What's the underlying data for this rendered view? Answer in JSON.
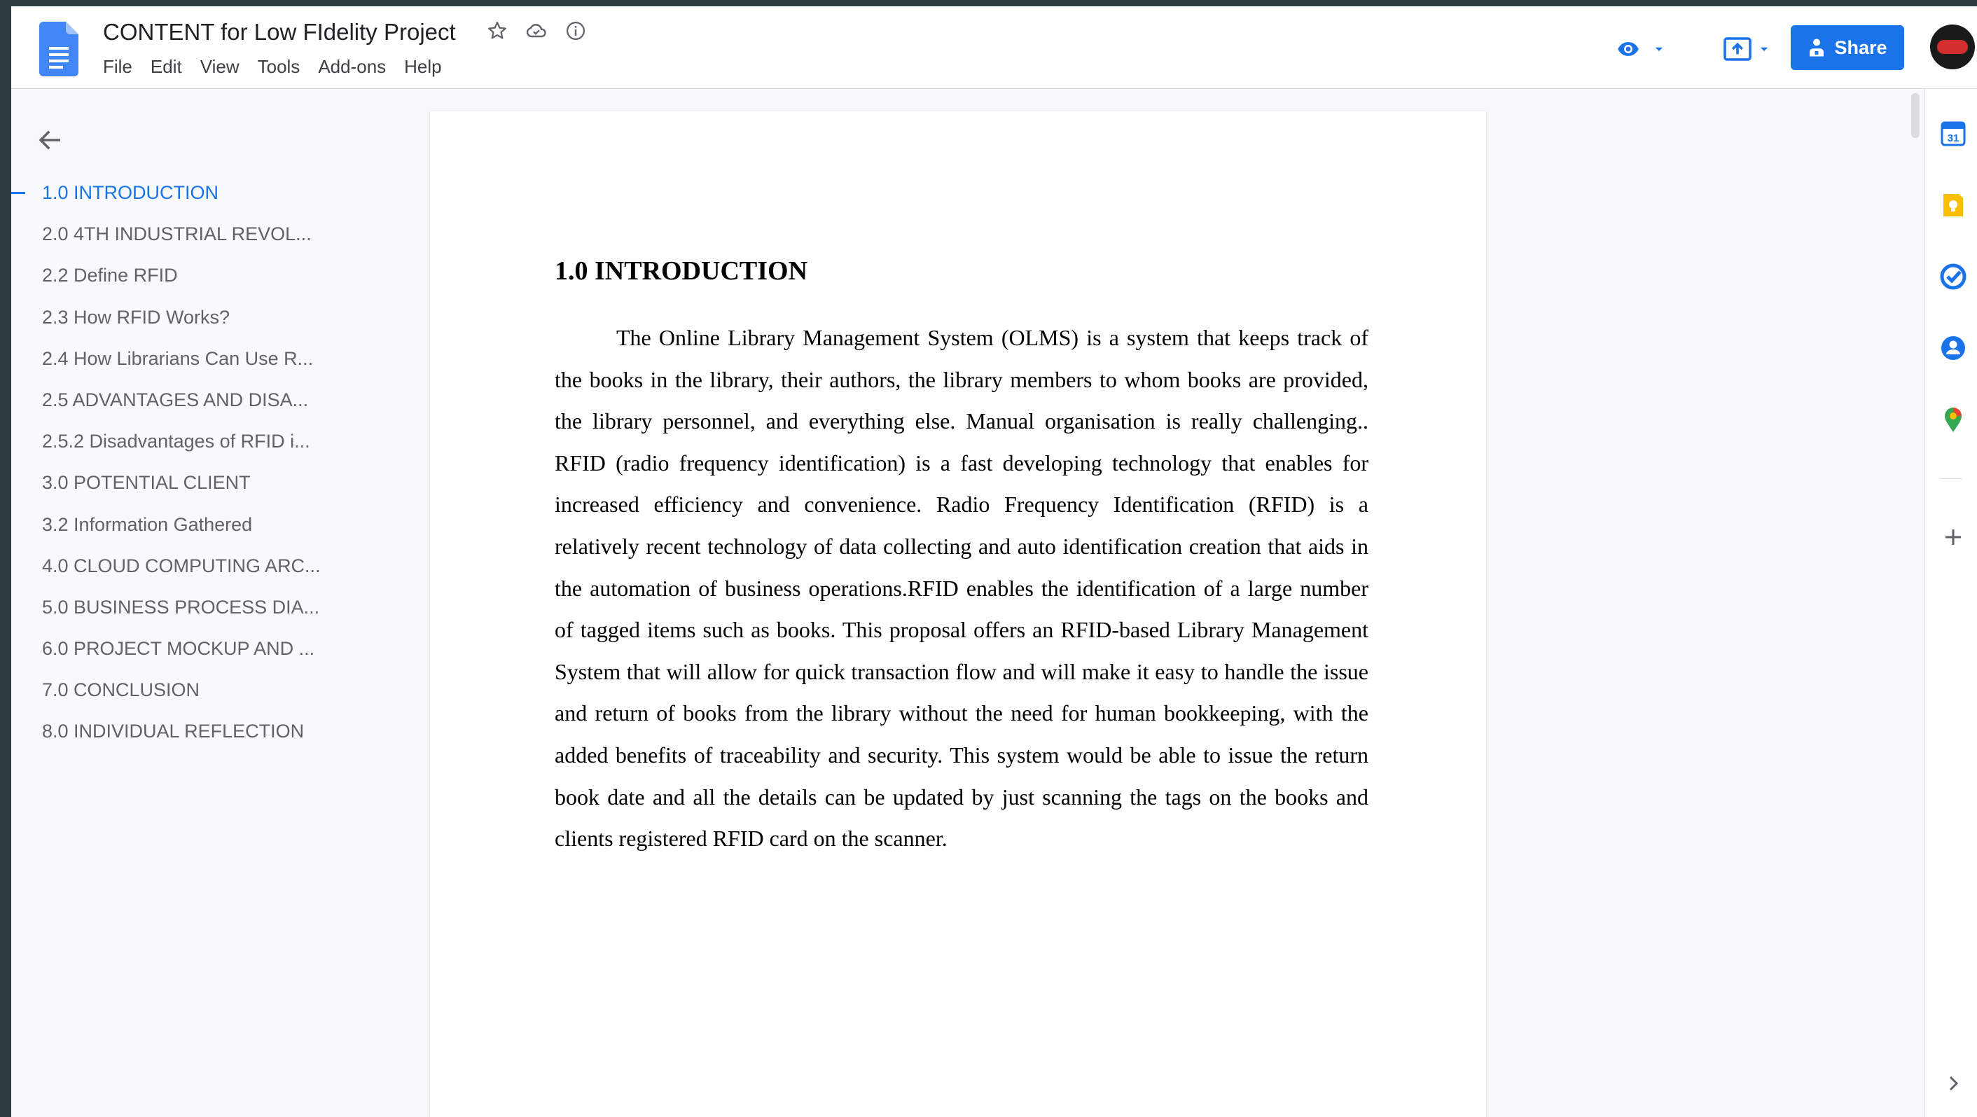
{
  "document": {
    "title": "CONTENT for Low FIdelity Project"
  },
  "menu": [
    "File",
    "Edit",
    "View",
    "Tools",
    "Add-ons",
    "Help"
  ],
  "toolbar": {
    "share_label": "Share"
  },
  "outline": [
    {
      "label": "1.0 INTRODUCTION",
      "active": true
    },
    {
      "label": "2.0 4TH INDUSTRIAL REVOL...",
      "active": false
    },
    {
      "label": "2.2 Define RFID",
      "active": false
    },
    {
      "label": "2.3 How RFID Works?",
      "active": false
    },
    {
      "label": "2.4 How Librarians Can Use R...",
      "active": false
    },
    {
      "label": "2.5 ADVANTAGES AND DISA...",
      "active": false
    },
    {
      "label": "2.5.2 Disadvantages of RFID i...",
      "active": false
    },
    {
      "label": "3.0 POTENTIAL CLIENT",
      "active": false
    },
    {
      "label": "3.2 Information Gathered",
      "active": false
    },
    {
      "label": "4.0 CLOUD COMPUTING ARC...",
      "active": false
    },
    {
      "label": "5.0 BUSINESS PROCESS DIA...",
      "active": false
    },
    {
      "label": "6.0 PROJECT MOCKUP AND ...",
      "active": false
    },
    {
      "label": "7.0 CONCLUSION",
      "active": false
    },
    {
      "label": "8.0 INDIVIDUAL REFLECTION",
      "active": false
    }
  ],
  "page": {
    "heading": "1.0 INTRODUCTION",
    "paragraph": "The Online Library Management System (OLMS) is a system that keeps track of the books in the library, their authors, the library members to whom books are provided, the library personnel, and everything else. Manual organisation is really challenging.. RFID (radio frequency identification) is a fast developing technology that enables for increased efficiency and convenience. Radio Frequency Identification (RFID) is a relatively recent technology of data collecting and auto identification creation that aids in the automation of business operations.RFID enables the identification of a large number of tagged items such as books. This proposal offers an RFID-based Library Management System that will allow for quick transaction flow and will make it easy to handle the issue and return of books from the library without the need for human bookkeeping, with the added benefits of traceability and security. This system would be able to issue the return book date and all the details can be updated by just scanning the tags on the books and clients registered RFID card on the scanner."
  },
  "side_panel": {
    "calendar_badge": "31"
  },
  "colors": {
    "accent": "#1a73e8",
    "keep": "#fbbc04",
    "maps_green": "#34a853",
    "maps_red": "#ea4335"
  }
}
